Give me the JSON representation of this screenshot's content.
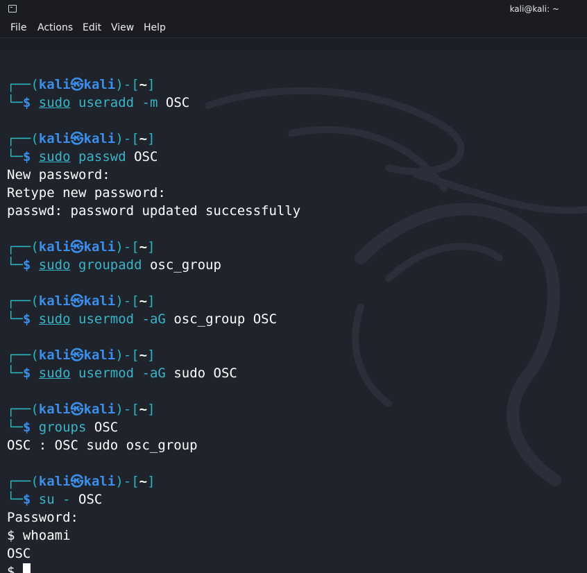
{
  "window": {
    "title": "kali@kali: ~",
    "icon": "terminal-icon"
  },
  "menu": {
    "items": [
      "File",
      "Actions",
      "Edit",
      "View",
      "Help"
    ]
  },
  "prompt": {
    "corner_top": "┌──(",
    "user": "kali",
    "at_symbol": "㉿",
    "host": "kali",
    "mid": ")-[",
    "cwd": "~",
    "close": "]",
    "corner_bottom": "└─",
    "dollar": "$"
  },
  "blocks": [
    {
      "sudo": "sudo",
      "command": "useradd",
      "flags": "-m",
      "args": "OSC",
      "output": []
    },
    {
      "sudo": "sudo",
      "command": "passwd",
      "flags": "",
      "args": "OSC",
      "output": [
        "New password:",
        "Retype new password:",
        "passwd: password updated successfully"
      ]
    },
    {
      "sudo": "sudo",
      "command": "groupadd",
      "flags": "",
      "args": "osc_group",
      "output": []
    },
    {
      "sudo": "sudo",
      "command": "usermod",
      "flags": "-aG",
      "args": "osc_group OSC",
      "output": []
    },
    {
      "sudo": "sudo",
      "command": "usermod",
      "flags": "-aG",
      "args": "sudo OSC",
      "output": []
    },
    {
      "sudo": "",
      "command": "groups",
      "flags": "",
      "args": "OSC",
      "output": [
        "OSC : OSC sudo osc_group"
      ]
    },
    {
      "sudo": "",
      "command": "su",
      "flags": "-",
      "args": "OSC",
      "output": [
        "Password:",
        "$ whoami",
        "OSC"
      ]
    }
  ],
  "final_prompt": "$ ",
  "colors": {
    "background": "#1f232b",
    "prompt_tree": "#2bb7c0",
    "prompt_user": "#3b8eea",
    "command": "#3bb4c8",
    "text": "#ffffff"
  }
}
